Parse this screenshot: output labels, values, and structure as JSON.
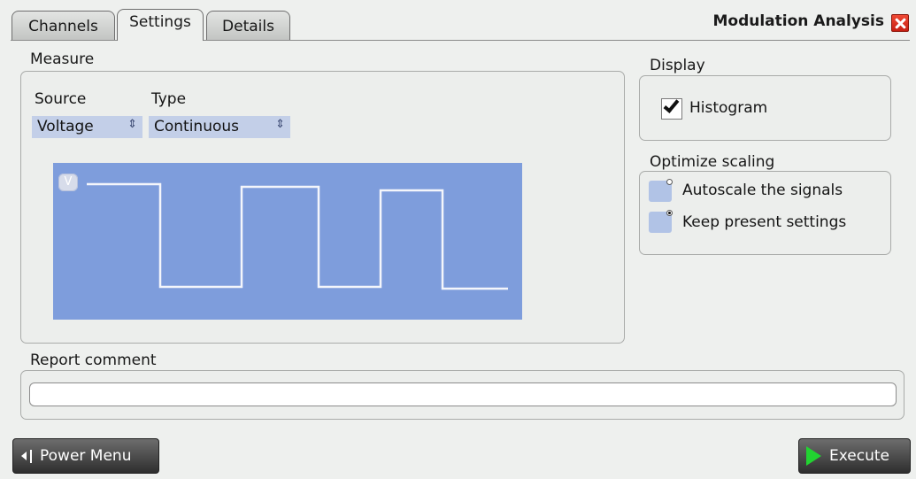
{
  "tabs": [
    {
      "label": "Channels",
      "active": false
    },
    {
      "label": "Settings",
      "active": true
    },
    {
      "label": "Details",
      "active": false
    }
  ],
  "dialog": {
    "title": "Modulation Analysis",
    "close_icon": "close-icon"
  },
  "measure": {
    "legend": "Measure",
    "source": {
      "label": "Source",
      "value": "Voltage"
    },
    "type": {
      "label": "Type",
      "value": "Continuous"
    },
    "diagram": {
      "badge": "V",
      "background": "#7e9ddc",
      "signal_color": "#ffffff"
    }
  },
  "display": {
    "legend": "Display",
    "histogram": {
      "label": "Histogram",
      "checked": true
    }
  },
  "scaling": {
    "legend": "Optimize scaling",
    "options": [
      {
        "label": "Autoscale the signals",
        "selected": false
      },
      {
        "label": "Keep present settings",
        "selected": true
      }
    ]
  },
  "report": {
    "legend": "Report comment",
    "value": ""
  },
  "buttons": {
    "power_menu": "Power Menu",
    "execute": "Execute",
    "execute_icon_color": "#22d331"
  }
}
